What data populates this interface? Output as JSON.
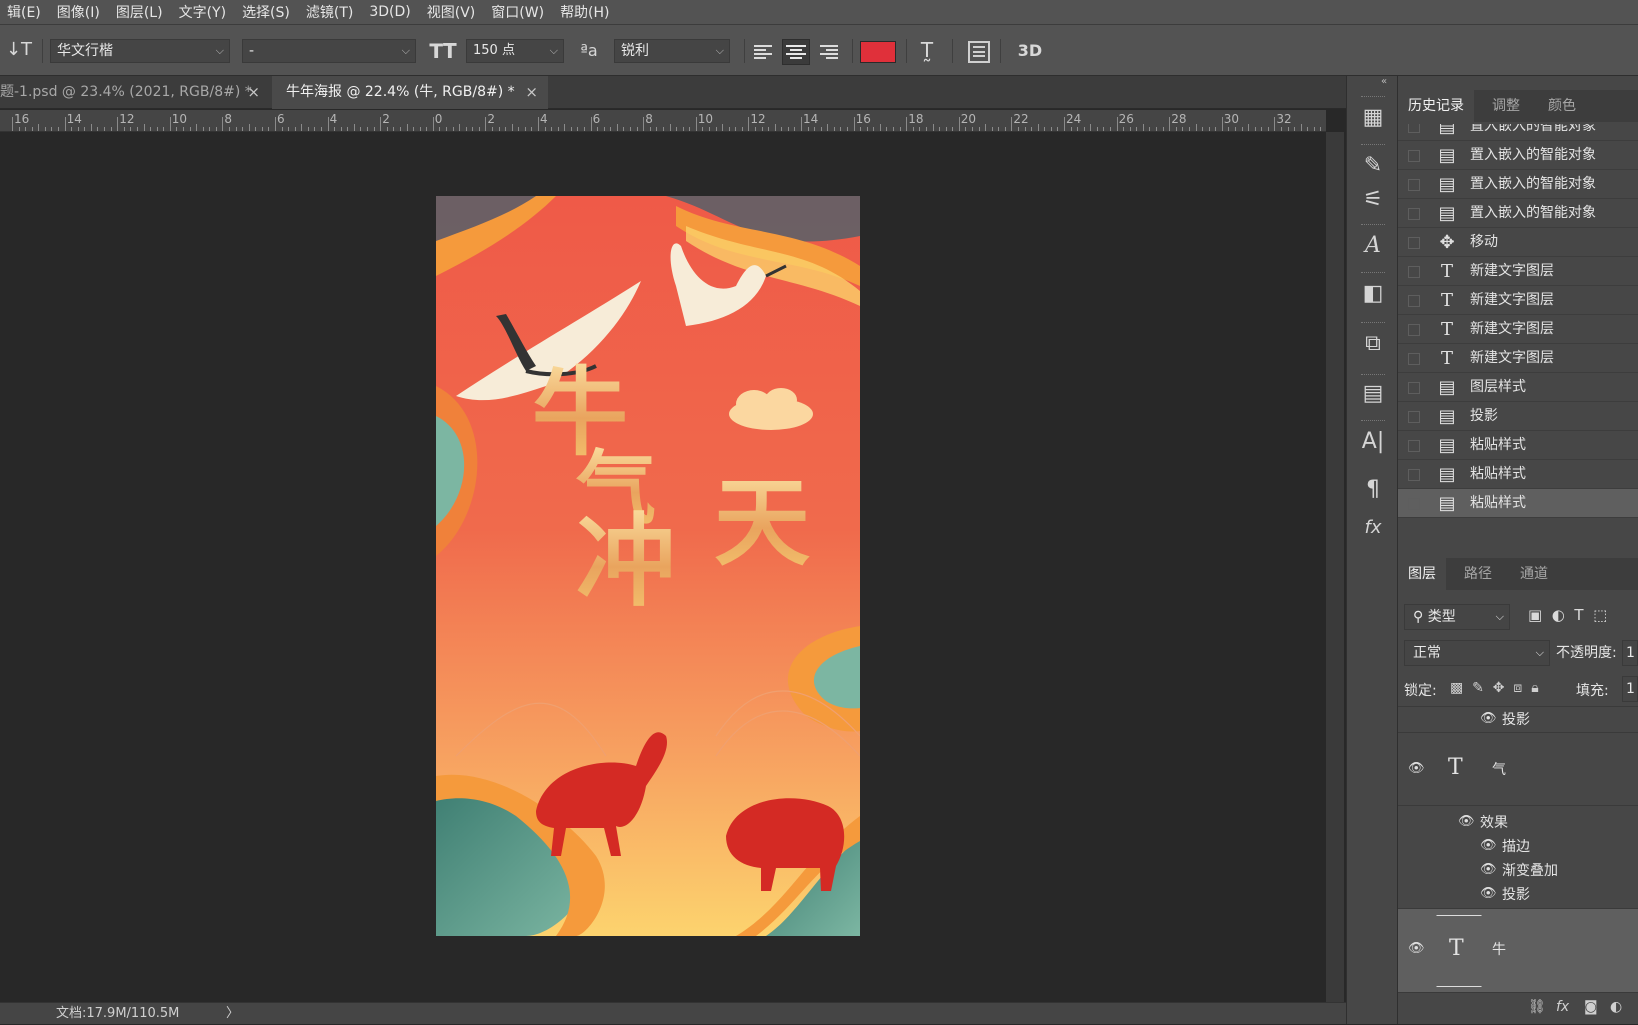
{
  "menu": [
    "辑(E)",
    "图像(I)",
    "图层(L)",
    "文字(Y)",
    "选择(S)",
    "滤镜(T)",
    "3D(D)",
    "视图(V)",
    "窗口(W)",
    "帮助(H)"
  ],
  "options": {
    "font_family": "华文行楷",
    "font_style": "-",
    "font_size": "150 点",
    "antialias": "锐利",
    "color": "#e0303a",
    "threed_label": "3D"
  },
  "tabs": [
    {
      "label": "题-1.psd @ 23.4% (2021, RGB/8#) *",
      "close": "×"
    },
    {
      "label": "牛年海报 @ 22.4% (牛, RGB/8#) *",
      "close": "×"
    }
  ],
  "ruler_ticks": [
    "16",
    "14",
    "12",
    "10",
    "8",
    "6",
    "4",
    "2",
    "0",
    "2",
    "4",
    "6",
    "8",
    "10",
    "12",
    "14",
    "16",
    "18",
    "20",
    "22",
    "24",
    "26",
    "28",
    "30",
    "32"
  ],
  "status": {
    "doc": "文档:17.9M/110.5M",
    "arrow": "〉"
  },
  "poster": {
    "chars": [
      "牛",
      "气",
      "冲",
      "天"
    ]
  },
  "history_panel": {
    "tabs": [
      "历史记录",
      "调整",
      "颜色"
    ],
    "items": [
      {
        "icon": "document-icon",
        "label": "置入嵌入的智能对象"
      },
      {
        "icon": "document-icon",
        "label": "置入嵌入的智能对象"
      },
      {
        "icon": "document-icon",
        "label": "置入嵌入的智能对象"
      },
      {
        "icon": "document-icon",
        "label": "置入嵌入的智能对象"
      },
      {
        "icon": "move-icon",
        "label": "移动"
      },
      {
        "icon": "text-icon",
        "label": "新建文字图层"
      },
      {
        "icon": "text-icon",
        "label": "新建文字图层"
      },
      {
        "icon": "text-icon",
        "label": "新建文字图层"
      },
      {
        "icon": "text-icon",
        "label": "新建文字图层"
      },
      {
        "icon": "document-icon",
        "label": "图层样式"
      },
      {
        "icon": "document-icon",
        "label": "投影"
      },
      {
        "icon": "document-icon",
        "label": "粘贴样式"
      },
      {
        "icon": "document-icon",
        "label": "粘贴样式"
      },
      {
        "icon": "document-icon",
        "label": "粘贴样式"
      }
    ]
  },
  "layers_panel": {
    "tabs": [
      "图层",
      "路径",
      "通道"
    ],
    "filter": "类型",
    "blend_mode": "正常",
    "opacity_label": "不透明度:",
    "opacity_value": "1",
    "lock_label": "锁定:",
    "fill_label": "填充:",
    "fill_value": "1",
    "rows": {
      "top_effect": "投影",
      "layer1_name": "气",
      "effects_label": "效果",
      "effect_stroke": "描边",
      "effect_gradient": "渐变叠加",
      "effect_shadow": "投影",
      "layer2_name": "牛"
    }
  }
}
